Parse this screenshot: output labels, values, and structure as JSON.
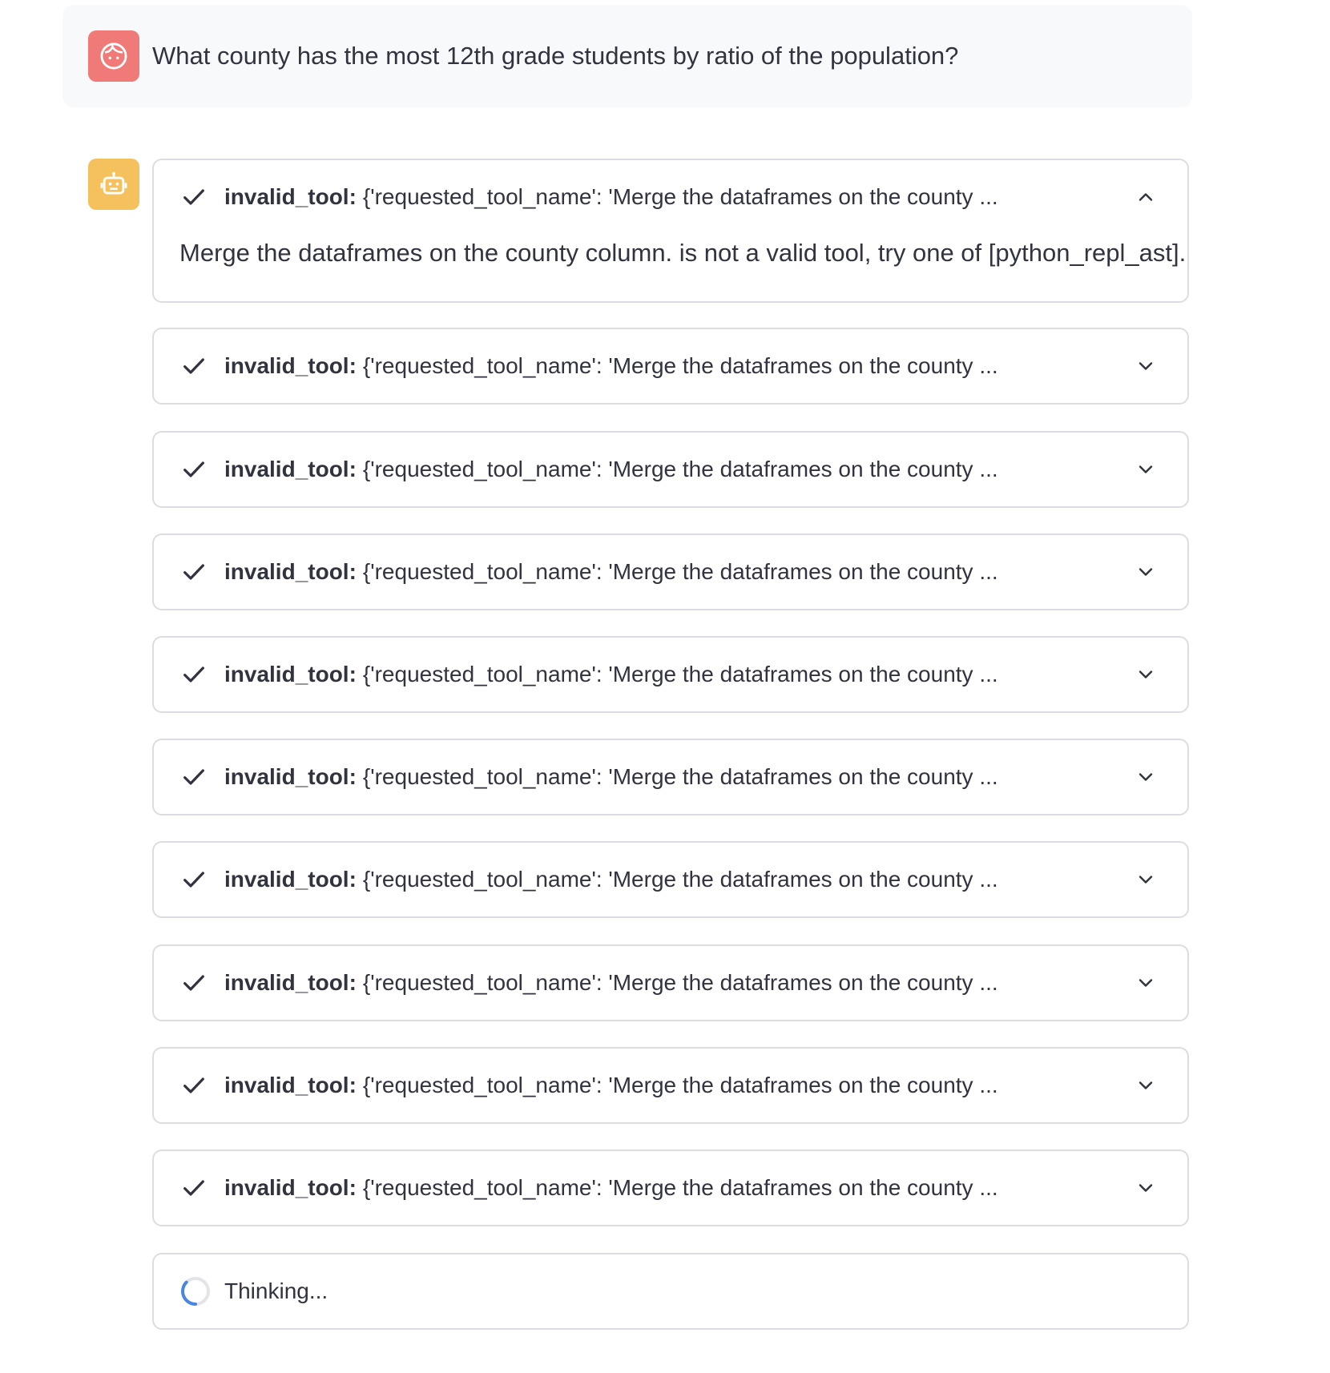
{
  "user_message": {
    "avatar_icon": "user-face-icon",
    "avatar_color": "#ef7a77",
    "text": "What county has the most 12th grade students by ratio of the population?"
  },
  "assistant": {
    "avatar_icon": "robot-icon",
    "avatar_color": "#f4c15c",
    "steps": [
      {
        "tool": "invalid_tool:",
        "summary": "{'requested_tool_name': 'Merge the dataframes on the county ...",
        "status_icon": "check-icon",
        "expanded": true,
        "body": "Merge the dataframes on the county column. is not a valid tool, try one of [python_repl_ast]."
      },
      {
        "tool": "invalid_tool:",
        "summary": "{'requested_tool_name': 'Merge the dataframes on the county ...",
        "status_icon": "check-icon",
        "expanded": false
      },
      {
        "tool": "invalid_tool:",
        "summary": "{'requested_tool_name': 'Merge the dataframes on the county ...",
        "status_icon": "check-icon",
        "expanded": false
      },
      {
        "tool": "invalid_tool:",
        "summary": "{'requested_tool_name': 'Merge the dataframes on the county ...",
        "status_icon": "check-icon",
        "expanded": false
      },
      {
        "tool": "invalid_tool:",
        "summary": "{'requested_tool_name': 'Merge the dataframes on the county ...",
        "status_icon": "check-icon",
        "expanded": false
      },
      {
        "tool": "invalid_tool:",
        "summary": "{'requested_tool_name': 'Merge the dataframes on the county ...",
        "status_icon": "check-icon",
        "expanded": false
      },
      {
        "tool": "invalid_tool:",
        "summary": "{'requested_tool_name': 'Merge the dataframes on the county ...",
        "status_icon": "check-icon",
        "expanded": false
      },
      {
        "tool": "invalid_tool:",
        "summary": "{'requested_tool_name': 'Merge the dataframes on the county ...",
        "status_icon": "check-icon",
        "expanded": false
      },
      {
        "tool": "invalid_tool:",
        "summary": "{'requested_tool_name': 'Merge the dataframes on the county ...",
        "status_icon": "check-icon",
        "expanded": false
      },
      {
        "tool": "invalid_tool:",
        "summary": "{'requested_tool_name': 'Merge the dataframes on the county ...",
        "status_icon": "check-icon",
        "expanded": false
      }
    ],
    "thinking": {
      "status_icon": "spinner-icon",
      "text": "Thinking..."
    }
  }
}
